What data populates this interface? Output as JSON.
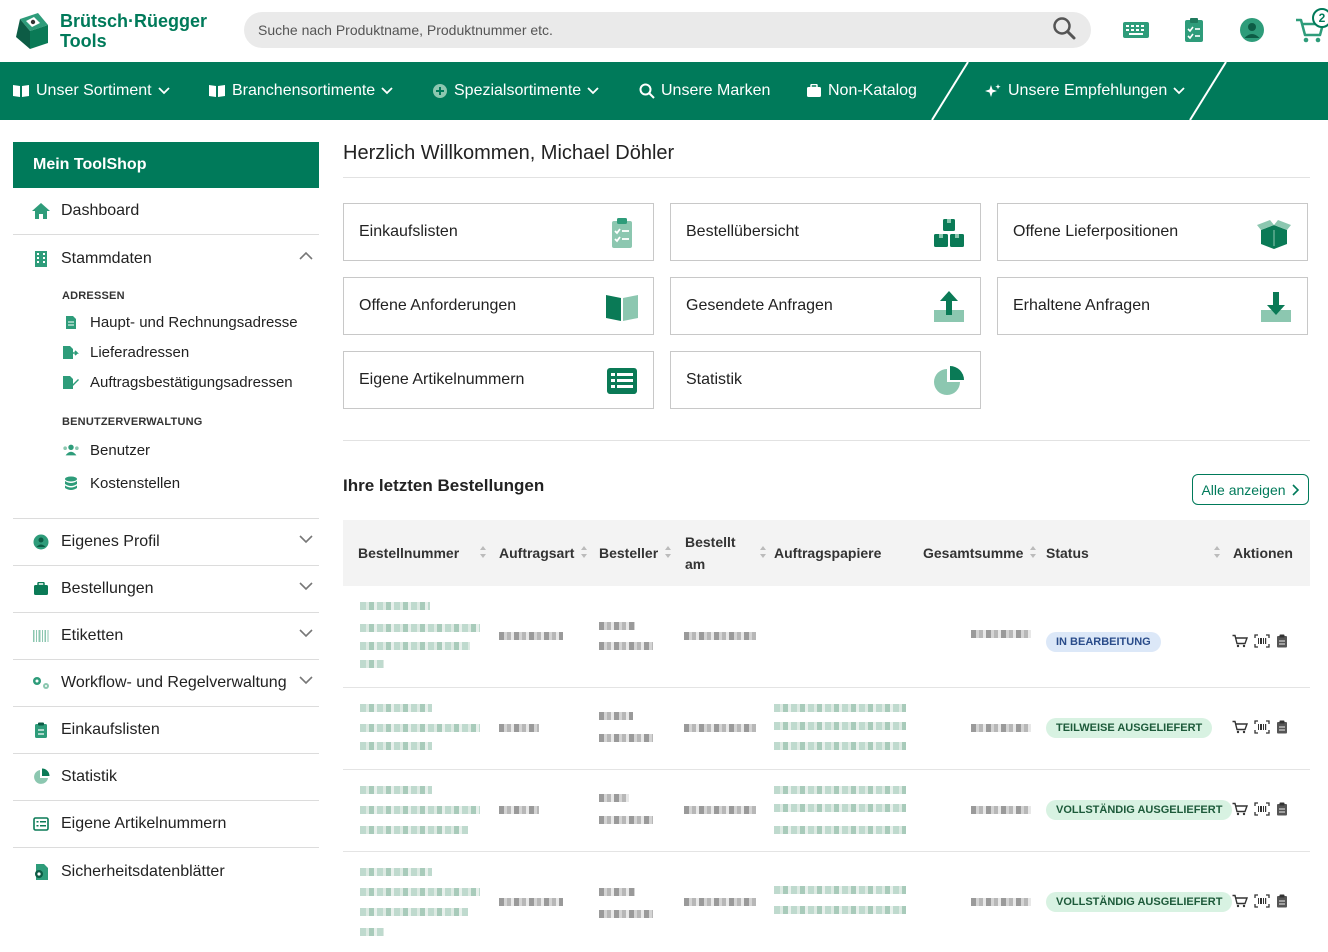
{
  "header": {
    "brand_line1": "Brütsch·Rüegger",
    "brand_line2": "Tools",
    "search_placeholder": "Suche nach Produktname, Produktnummer etc.",
    "cart_count": "2"
  },
  "nav": {
    "items": [
      {
        "label": "Unser Sortiment"
      },
      {
        "label": "Branchensortimente"
      },
      {
        "label": "Spezialsortimente"
      },
      {
        "label": "Unsere Marken"
      },
      {
        "label": "Non-Katalog"
      },
      {
        "label": "Unsere Empfehlungen"
      }
    ]
  },
  "sidebar": {
    "title": "Mein ToolShop",
    "dashboard": "Dashboard",
    "stammdaten": "Stammdaten",
    "adressen_head": "ADRESSEN",
    "adressen": [
      "Haupt- und Rechnungsadresse",
      "Lieferadressen",
      "Auftragsbestätigungsadressen"
    ],
    "benutzer_head": "BENUTZERVERWALTUNG",
    "benutzer": [
      "Benutzer",
      "Kostenstellen"
    ],
    "items": [
      "Eigenes Profil",
      "Bestellungen",
      "Etiketten",
      "Workflow- und Regelverwaltung",
      "Einkaufslisten",
      "Statistik",
      "Eigene Artikelnummern",
      "Sicherheitsdatenblätter"
    ]
  },
  "main": {
    "welcome": "Herzlich Willkommen, Michael Döhler",
    "tiles": [
      "Einkaufslisten",
      "Bestellübersicht",
      "Offene Lieferpositionen",
      "Offene Anforderungen",
      "Gesendete Anfragen",
      "Erhaltene Anfragen",
      "Eigene Artikelnummern",
      "Statistik"
    ],
    "orders_title": "Ihre letzten Bestellungen",
    "all_button": "Alle anzeigen",
    "columns": [
      "Bestellnummer",
      "Auftragsart",
      "Besteller",
      "Bestellt am",
      "Auftragspapiere",
      "Gesamtsumme",
      "Status",
      "Aktionen"
    ],
    "statuses": [
      "IN BEARBEITUNG",
      "TEILWEISE AUSGELIEFERT",
      "VOLLSTÄNDIG AUSGELIEFERT",
      "VOLLSTÄNDIG AUSGELIEFERT"
    ]
  },
  "colors": {
    "brand": "#007a5a",
    "status_blue_bg": "#dce8f8",
    "status_green_bg": "#d8f2e2"
  }
}
